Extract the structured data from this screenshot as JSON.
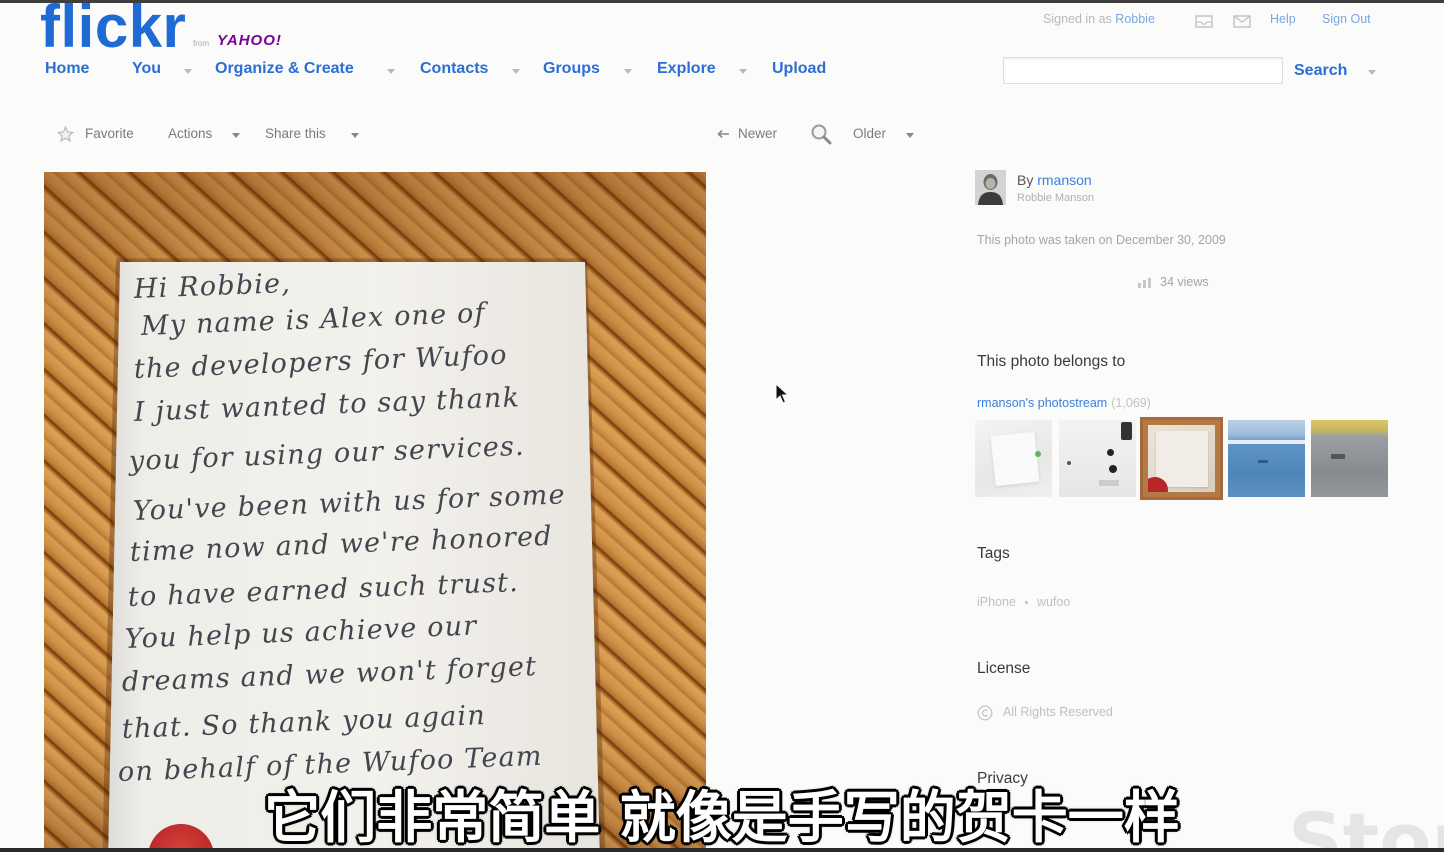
{
  "header": {
    "logo": {
      "wordmark": "flickr",
      "from": "from",
      "yahoo": "YAHOO!"
    },
    "account": {
      "signed_in_as": "Signed in as",
      "username": "Robbie",
      "help": "Help",
      "sign_out": "Sign Out"
    },
    "nav": [
      {
        "label": "Home"
      },
      {
        "label": "You"
      },
      {
        "label": "Organize & Create"
      },
      {
        "label": "Contacts"
      },
      {
        "label": "Groups"
      },
      {
        "label": "Explore"
      },
      {
        "label": "Upload"
      }
    ],
    "search": {
      "value": "",
      "placeholder": "",
      "button": "Search"
    }
  },
  "toolbar": {
    "favorite": "Favorite",
    "actions": "Actions",
    "share": "Share this",
    "newer": "Newer",
    "older": "Older"
  },
  "photo": {
    "note_lines": [
      "Hi Robbie,",
      "My name is Alex one of",
      "the developers for Wufoo",
      "I just wanted to say thank",
      "you for using our services.",
      "You've been with us for some",
      "time now and we're honored",
      "to have earned such trust.",
      "You help us achieve our",
      "dreams and we won't forget",
      "that. So thank you again",
      "on behalf of the Wufoo Team"
    ]
  },
  "sidebar": {
    "owner": {
      "by": "By",
      "username": "rmanson",
      "real_name": "Robbie Manson"
    },
    "taken_on": "This photo was taken on December 30, 2009",
    "views": "34 views",
    "belongs_heading": "This photo belongs to",
    "photostream": {
      "label": "rmanson's photostream",
      "count": "(1,069)",
      "selected_thumbnail": 3
    },
    "tags_heading": "Tags",
    "tags": [
      "iPhone",
      "wufoo"
    ],
    "license_heading": "License",
    "license": "All Rights Reserved",
    "privacy_heading": "Privacy"
  },
  "subtitle": "它们非常简单 就像是手写的贺卡一样",
  "watermark": "Stor",
  "colors": {
    "logo_blue": "#1f6bd4",
    "nav_blue": "#2a6ed6",
    "link_blue": "#3d80dc",
    "yahoo_purple": "#7b0099"
  },
  "icons": {
    "favorite": "star-icon",
    "zoom": "magnifier-icon",
    "newer": "arrow-left-icon",
    "views": "views-icon",
    "license": "copyright-icon",
    "account": [
      "inbox-icon",
      "mail-icon"
    ]
  }
}
